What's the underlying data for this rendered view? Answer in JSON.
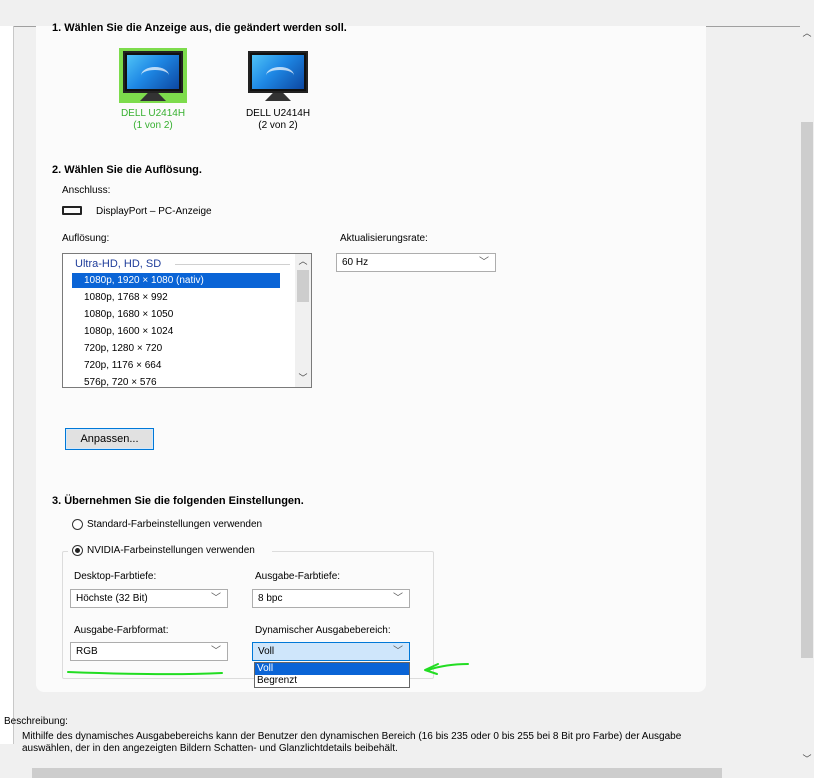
{
  "section1": {
    "title": "1. Wählen Sie die Anzeige aus, die geändert werden soll."
  },
  "monitors": [
    {
      "name": "DELL U2414H",
      "index": "(1 von 2)",
      "selected": true
    },
    {
      "name": "DELL U2414H",
      "index": "(2 von 2)",
      "selected": false
    }
  ],
  "section2": {
    "title": "2. Wählen Sie die Auflösung.",
    "connection_label": "Anschluss:",
    "connection_value": "DisplayPort – PC-Anzeige",
    "resolution_label": "Auflösung:",
    "refresh_label": "Aktualisierungsrate:",
    "refresh_value": "60 Hz",
    "resolution_group": "Ultra-HD, HD, SD",
    "resolutions": [
      "1080p, 1920 × 1080 (nativ)",
      "1080p, 1768 × 992",
      "1080p, 1680 × 1050",
      "1080p, 1600 × 1024",
      "720p, 1280 × 720",
      "720p, 1176 × 664",
      "576p, 720 × 576"
    ],
    "customize_button": "Anpassen..."
  },
  "section3": {
    "title": "3. Übernehmen Sie die folgenden Einstellungen.",
    "radio_default": "Standard-Farbeinstellungen verwenden",
    "radio_nvidia": "NVIDIA-Farbeinstellungen verwenden",
    "desktop_depth_label": "Desktop-Farbtiefe:",
    "desktop_depth_value": "Höchste (32 Bit)",
    "output_depth_label": "Ausgabe-Farbtiefe:",
    "output_depth_value": "8 bpc",
    "output_format_label": "Ausgabe-Farbformat:",
    "output_format_value": "RGB",
    "dynamic_range_label": "Dynamischer Ausgabebereich:",
    "dynamic_range_value": "Voll",
    "dynamic_range_options": [
      "Voll",
      "Begrenzt"
    ]
  },
  "description": {
    "label": "Beschreibung:",
    "line1": "Mithilfe des dynamisches Ausgabebereichs kann der Benutzer den dynamischen Bereich (16 bis 235 oder 0 bis 255 bei 8 Bit pro Farbe) der Ausgabe",
    "line2": "auswählen, der in den angezeigten Bildern Schatten- und Glanzlichtdetails beibehält."
  },
  "colors": {
    "selected_monitor": "#37b030",
    "annotation_green": "#22dd22",
    "list_selection": "#0a64d6",
    "group_heading": "#1e3c9a"
  }
}
